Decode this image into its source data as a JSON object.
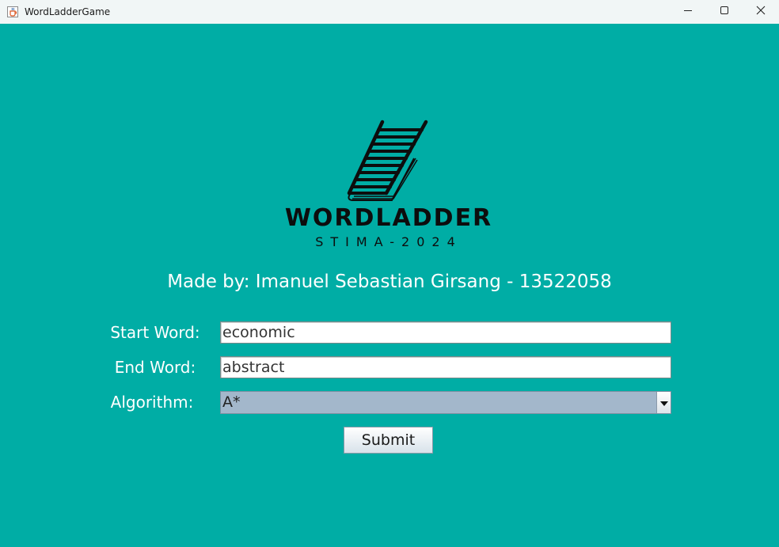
{
  "window": {
    "title": "WordLadderGame",
    "icon": "java-cup-icon",
    "controls": [
      "minimize-icon",
      "maximize-icon",
      "close-icon"
    ]
  },
  "logo": {
    "title": "WORDLADDER",
    "subtitle": "STIMA-2024",
    "icon": "ladder-book-icon"
  },
  "credits": "Made by: Imanuel Sebastian Girsang - 13522058",
  "form": {
    "start_label": "Start Word:",
    "start_value": "economic",
    "end_label": "End Word:",
    "end_value": "abstract",
    "algorithm_label": "Algorithm:",
    "algorithm_value": "A*",
    "submit_label": "Submit"
  },
  "colors": {
    "background": "#00ada5",
    "titlebar": "#f1f6f6",
    "select_fill": "#a3b7cb"
  }
}
